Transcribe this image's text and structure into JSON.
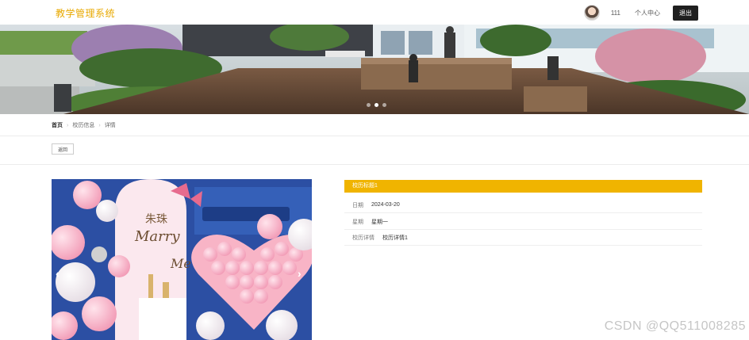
{
  "header": {
    "logo": "教学管理系统",
    "user_name": "111",
    "center_link": "个人中心",
    "logout_label": "退出"
  },
  "banner": {
    "slide_count": 3,
    "active_slide": 2
  },
  "breadcrumb": {
    "home": "首页",
    "section": "校历信息",
    "current": "详情"
  },
  "toolbar": {
    "collect_label": "返回"
  },
  "detail": {
    "title": "校历标题1",
    "date_label": "日期",
    "date_value": "2024-03-20",
    "weekday_label": "星期",
    "weekday_value": "星期一",
    "content_label": "校历详情",
    "content_value": "校历详情1"
  },
  "photo": {
    "text_cn": "朱珠",
    "text_script": "Marry",
    "text_script2": "Me"
  },
  "watermark": "CSDN @QQ511008285",
  "colors": {
    "accent": "#f0b400",
    "logo": "#e8a900",
    "logout_bg": "#1f1f1f"
  }
}
